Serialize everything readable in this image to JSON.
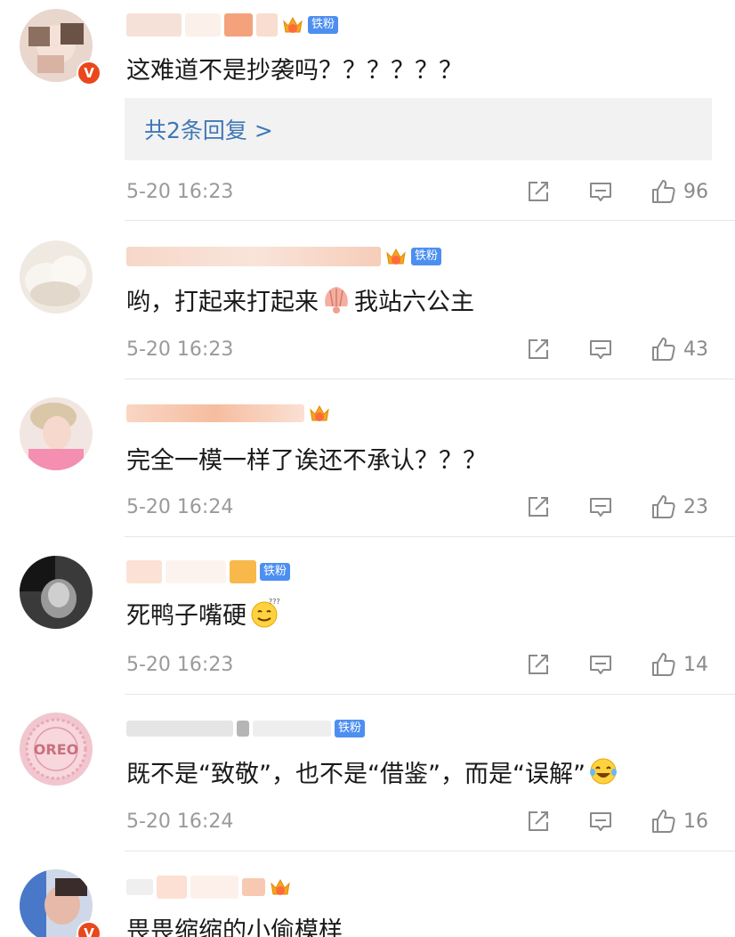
{
  "comments": [
    {
      "text": "这难道不是抄袭吗？？？？？？",
      "fan_badge": "铁粉",
      "crown_level": "5",
      "reply_summary": "共2条回复 >",
      "time": "5-20 16:23",
      "likes": "96",
      "verified": true
    },
    {
      "text_before": "哟，打起来打起来",
      "text_after": "我站六公主",
      "emoji": "shell-emoji",
      "fan_badge": "铁粉",
      "crown_level": "6",
      "time": "5-20 16:23",
      "likes": "43"
    },
    {
      "text": "完全一模一样了诶还不承认？？？",
      "crown_level": "1",
      "time": "5-20 16:24",
      "likes": "23"
    },
    {
      "text": "死鸭子嘴硬",
      "emoji": "confused-smile-emoji",
      "fan_badge": "铁粉",
      "time": "5-20 16:23",
      "likes": "14"
    },
    {
      "text": "既不是“致敬”，也不是“借鉴”，而是“误解”",
      "emoji": "laughing-tears-emoji",
      "fan_badge": "铁粉",
      "time": "5-20 16:24",
      "likes": "16",
      "avatar_text": "OREO"
    },
    {
      "text": "畏畏缩缩的小偷模样",
      "crown_level": "6",
      "verified": true
    }
  ],
  "icons": {
    "share": "share-icon",
    "comment": "comment-icon",
    "like": "thumbs-up-icon"
  },
  "colors": {
    "link_blue": "#3f77b5",
    "fan_badge_blue": "#4d8ff1",
    "meta_gray": "#9a9a9a",
    "verified_orange": "#e8481c",
    "crown_gold": "#f5a623"
  }
}
